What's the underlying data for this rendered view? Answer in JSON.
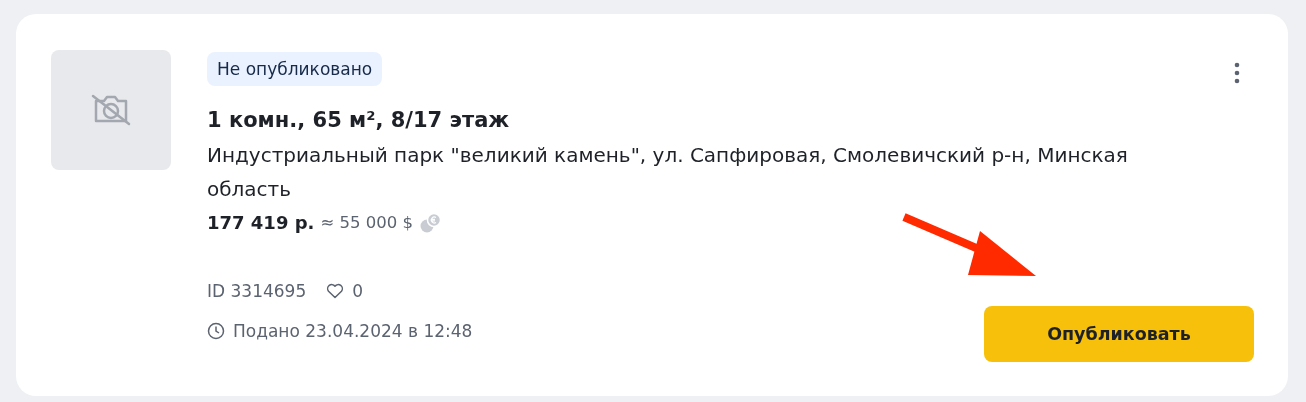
{
  "listing": {
    "status_badge": "Не опубликовано",
    "title": "1 комн., 65 м², 8/17 этаж",
    "address": "Индустриальный парк \"великий камень\", ул. Сапфировая, Смолевичский р-н, Минская область",
    "price": "177 419 р.",
    "price_converted": "≈ 55 000 $",
    "id": "ID 3314695",
    "likes": "0",
    "submitted": "Подано 23.04.2024 в 12:48",
    "publish_button": "Опубликовать"
  }
}
